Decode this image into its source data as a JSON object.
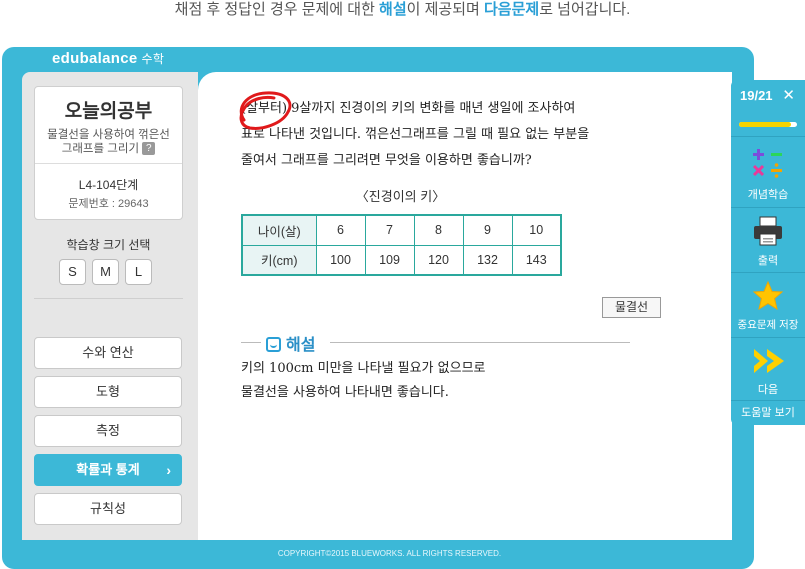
{
  "caption": {
    "part1": "채점 후 정답인 경우 문제에 대한 ",
    "highlight1": "해설",
    "part2": "이 제공되며 ",
    "highlight2": "다음문제",
    "part3": "로 넘어갑니다."
  },
  "brand": {
    "name": "edubalance",
    "sub": "수학"
  },
  "sidebar": {
    "card_title": "오늘의공부",
    "card_desc_line1": "물결선을 사용하여 꺾은선",
    "card_desc_line2": "그래프를 그리기",
    "help_icon_text": "?",
    "lesson_code": "L4-104단계",
    "lesson_number": "문제번호 : 29643",
    "size_label": "학습창 크기 선택",
    "size_options": [
      "S",
      "M",
      "L"
    ],
    "categories": [
      "수와 연산",
      "도형",
      "측정",
      "확률과 통계",
      "규칙성"
    ],
    "active_category": "확률과 통계",
    "chevron": "›"
  },
  "question": {
    "line1": "(살부터) 9살까지 진경이의 키의 변화를 매년 생일에 조사하여",
    "line2": "표로 나타낸 것입니다. 꺾은선그래프를 그릴 때 필요 없는 부분을",
    "line3": "줄여서 그래프를 그리려면 무엇을 이용하면 좋습니까?"
  },
  "table": {
    "caption": "〈진경이의 키〉",
    "row1": [
      "나이(살)",
      "6",
      "7",
      "8",
      "9",
      "10"
    ],
    "row2": [
      "키(cm)",
      "100",
      "109",
      "120",
      "132",
      "143"
    ]
  },
  "answer_button": "물결선",
  "explanation": {
    "title": "해설",
    "line1": "키의 100cm 미만을 나타낼 필요가 없으므로",
    "line2": "물결선을 사용하여 나타내면 좋습니다."
  },
  "footer": "COPYRIGHT©2015 BLUEWORKS. ALL RIGHTS RESERVED.",
  "right_panel": {
    "counter": "19/21",
    "close_glyph": "✕",
    "progress_fraction": 0.9,
    "buttons": [
      "개념학습",
      "출력",
      "중요문제 저장",
      "다음"
    ],
    "help": "도움말 보기"
  },
  "colors": {
    "accent": "#3cb8d7",
    "table_border": "#2aa89d",
    "mark_red": "#e0191b",
    "progress_fill": "#f5d300"
  }
}
